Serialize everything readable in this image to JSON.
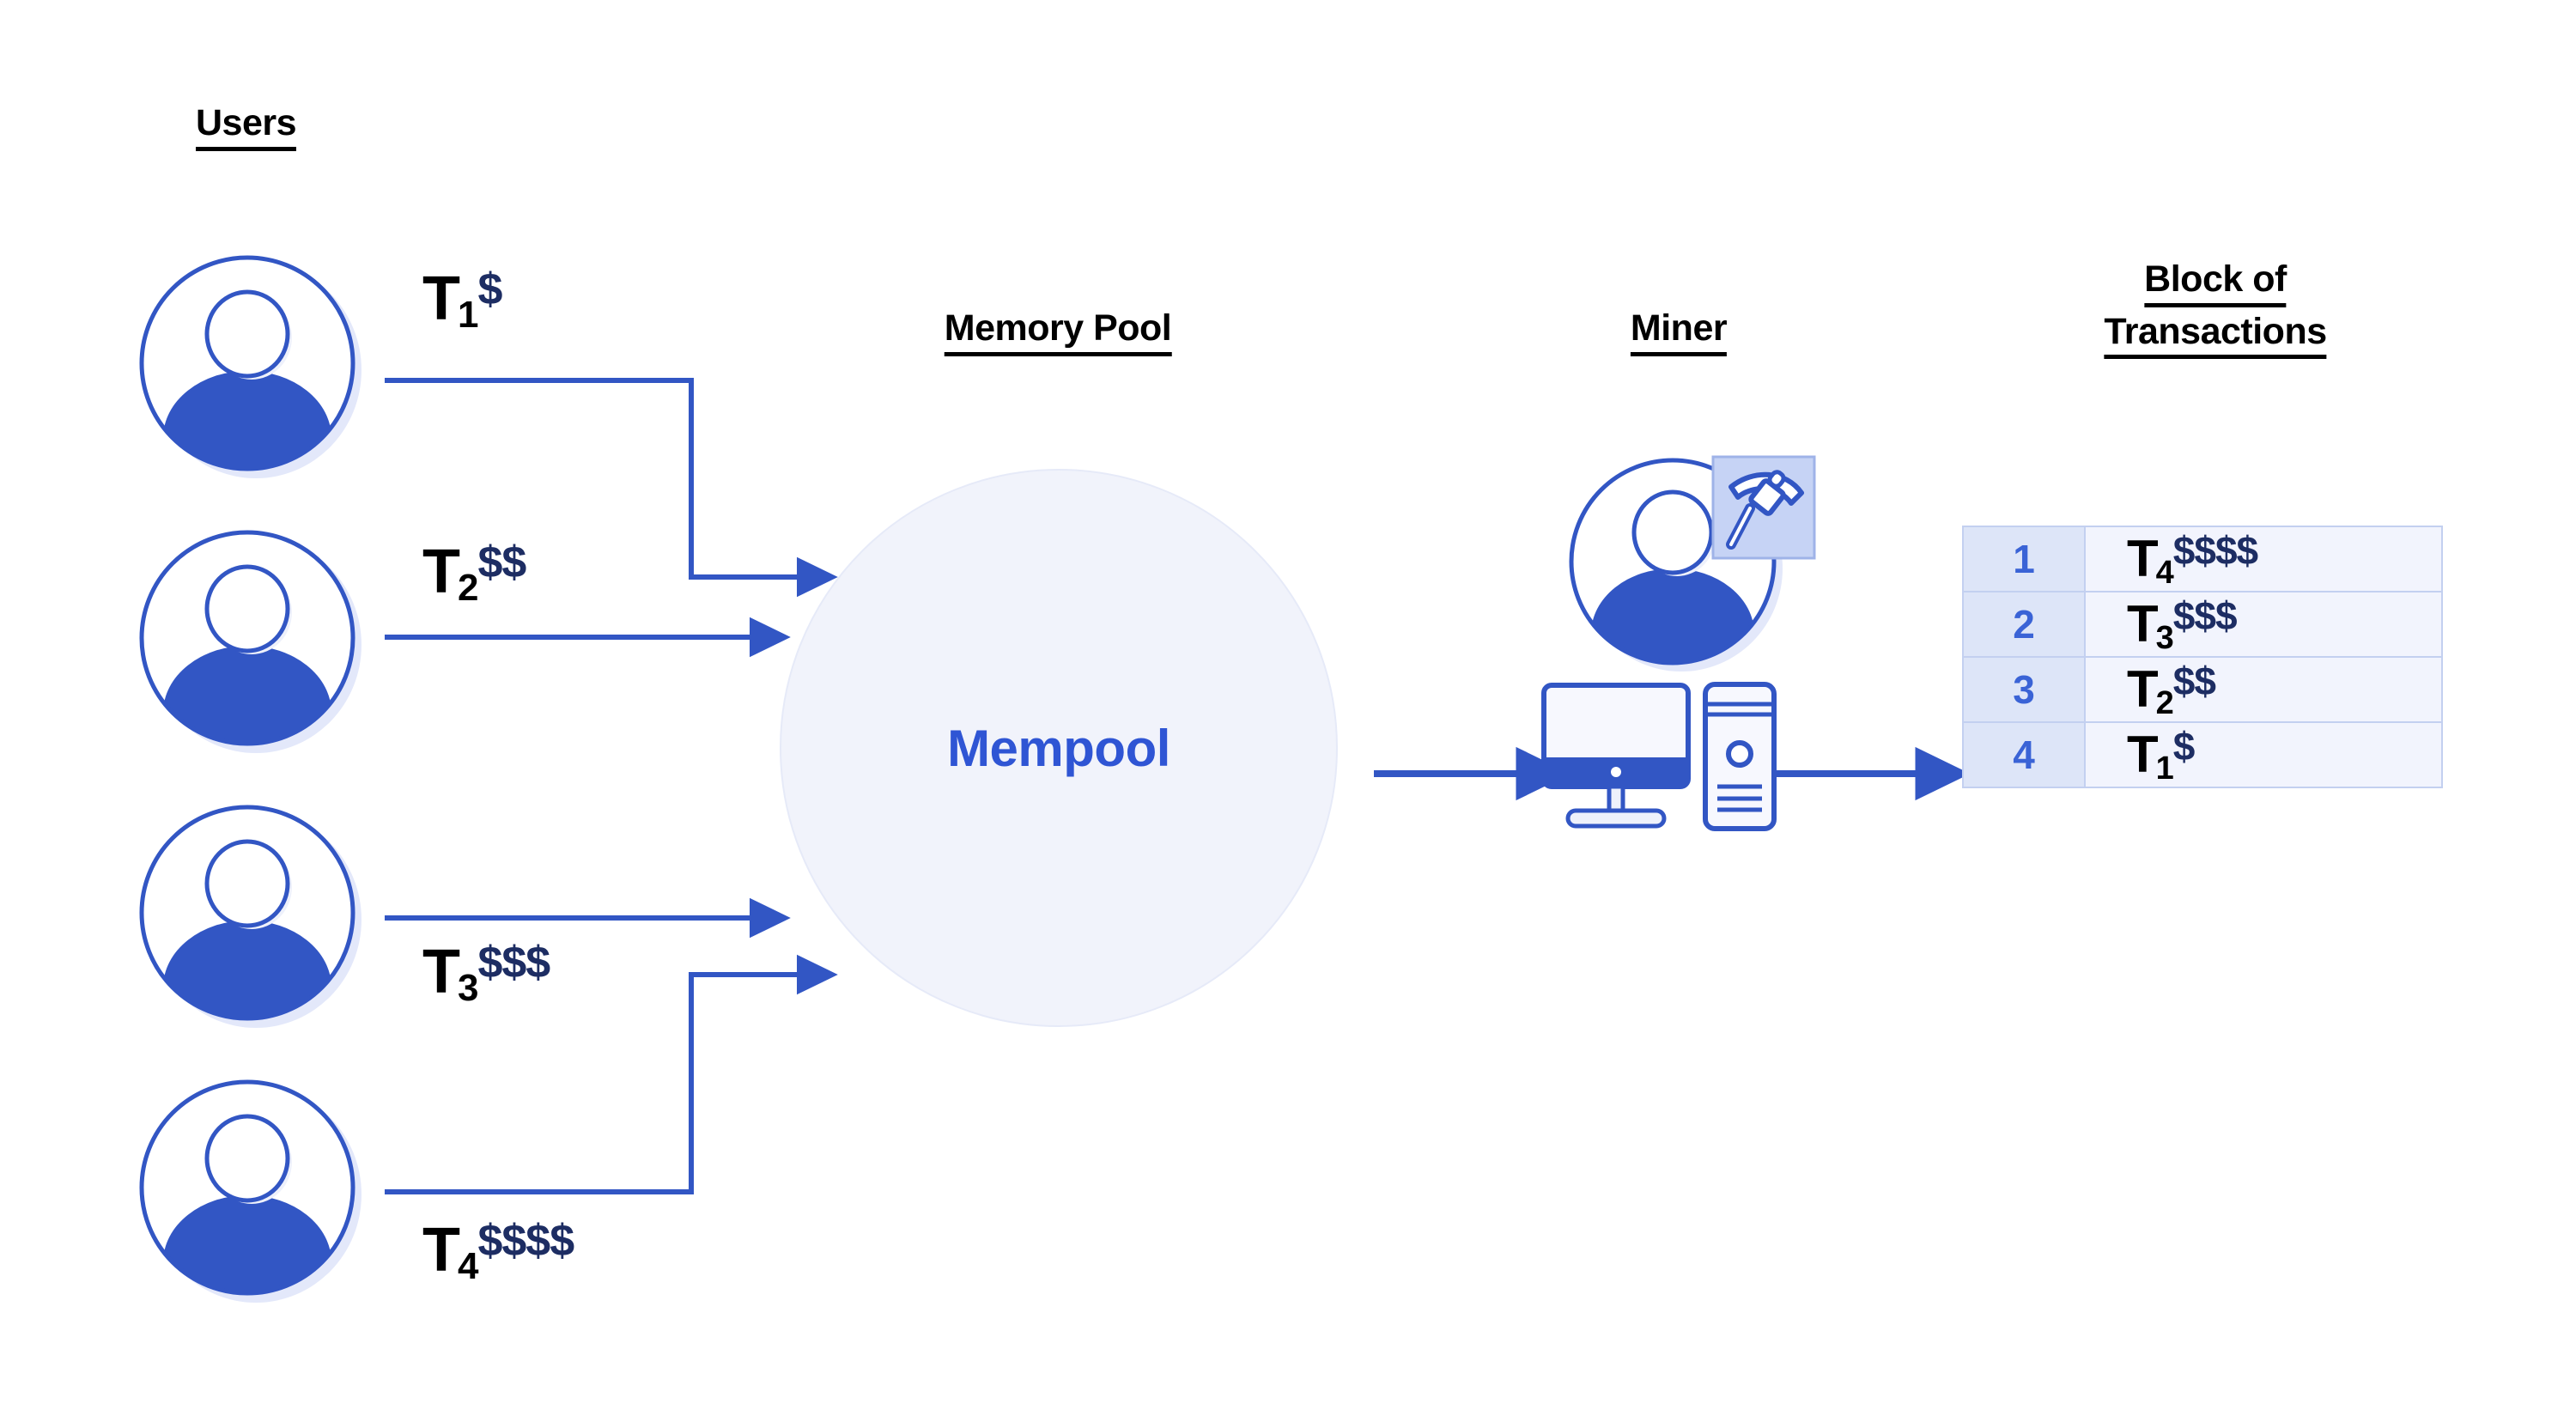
{
  "diagram": {
    "title": "Blockchain transaction mempool flow",
    "background": "#ffffff"
  },
  "colors": {
    "accent_blue": "#2f55d4",
    "line_blue": "#3a63d6",
    "fee_navy": "#1d2d63",
    "mempool_fill": "#f1f3fb",
    "mempool_border": "#e6eaf8",
    "table_index_bg": "#dde5f8",
    "table_cell_bg": "#f2f4fd",
    "table_border": "#c3d0f0",
    "avatar_stroke": "#3256c4",
    "avatar_body": "#3256c4",
    "avatar_shadow": "#e3e8fa",
    "badge_bg": "#c6d3f5",
    "heading_black": "#000000"
  },
  "headings": {
    "users": "Users",
    "memory_pool": "Memory Pool",
    "miner": "Miner",
    "block_line1": "Block of",
    "block_line2": "Transactions"
  },
  "users": [
    {
      "avatar_name": "user-avatar-1",
      "tx": "T",
      "index": "1",
      "fee": "$",
      "fee_count": 1,
      "route": "right-down-right"
    },
    {
      "avatar_name": "user-avatar-2",
      "tx": "T",
      "index": "2",
      "fee": "$$",
      "fee_count": 2,
      "route": "straight"
    },
    {
      "avatar_name": "user-avatar-3",
      "tx": "T",
      "index": "3",
      "fee": "$$$",
      "fee_count": 3,
      "route": "straight"
    },
    {
      "avatar_name": "user-avatar-4",
      "tx": "T",
      "index": "4",
      "fee": "$$$$",
      "fee_count": 4,
      "route": "right-up-right"
    }
  ],
  "mempool": {
    "label": "Mempool"
  },
  "miner": {
    "badge_icon": "pickaxe-icon",
    "avatar_icon": "person-avatar-icon",
    "monitor_icon": "desktop-monitor-icon",
    "tower_icon": "computer-tower-icon"
  },
  "block_table": {
    "rows": [
      {
        "index": "1",
        "tx": "T",
        "sub": "4",
        "fee": "$$$$",
        "fee_count": 4
      },
      {
        "index": "2",
        "tx": "T",
        "sub": "3",
        "fee": "$$$",
        "fee_count": 3
      },
      {
        "index": "3",
        "tx": "T",
        "sub": "2",
        "fee": "$$",
        "fee_count": 2
      },
      {
        "index": "4",
        "tx": "T",
        "sub": "1",
        "fee": "$",
        "fee_count": 1
      }
    ]
  },
  "arrows": [
    {
      "name": "arrow-user1-to-mempool",
      "from": "user-avatar-1",
      "to": "mempool"
    },
    {
      "name": "arrow-user2-to-mempool",
      "from": "user-avatar-2",
      "to": "mempool"
    },
    {
      "name": "arrow-user3-to-mempool",
      "from": "user-avatar-3",
      "to": "mempool"
    },
    {
      "name": "arrow-user4-to-mempool",
      "from": "user-avatar-4",
      "to": "mempool"
    },
    {
      "name": "arrow-mempool-to-miner",
      "from": "mempool",
      "to": "miner"
    },
    {
      "name": "arrow-miner-to-block",
      "from": "miner",
      "to": "block-table"
    }
  ]
}
